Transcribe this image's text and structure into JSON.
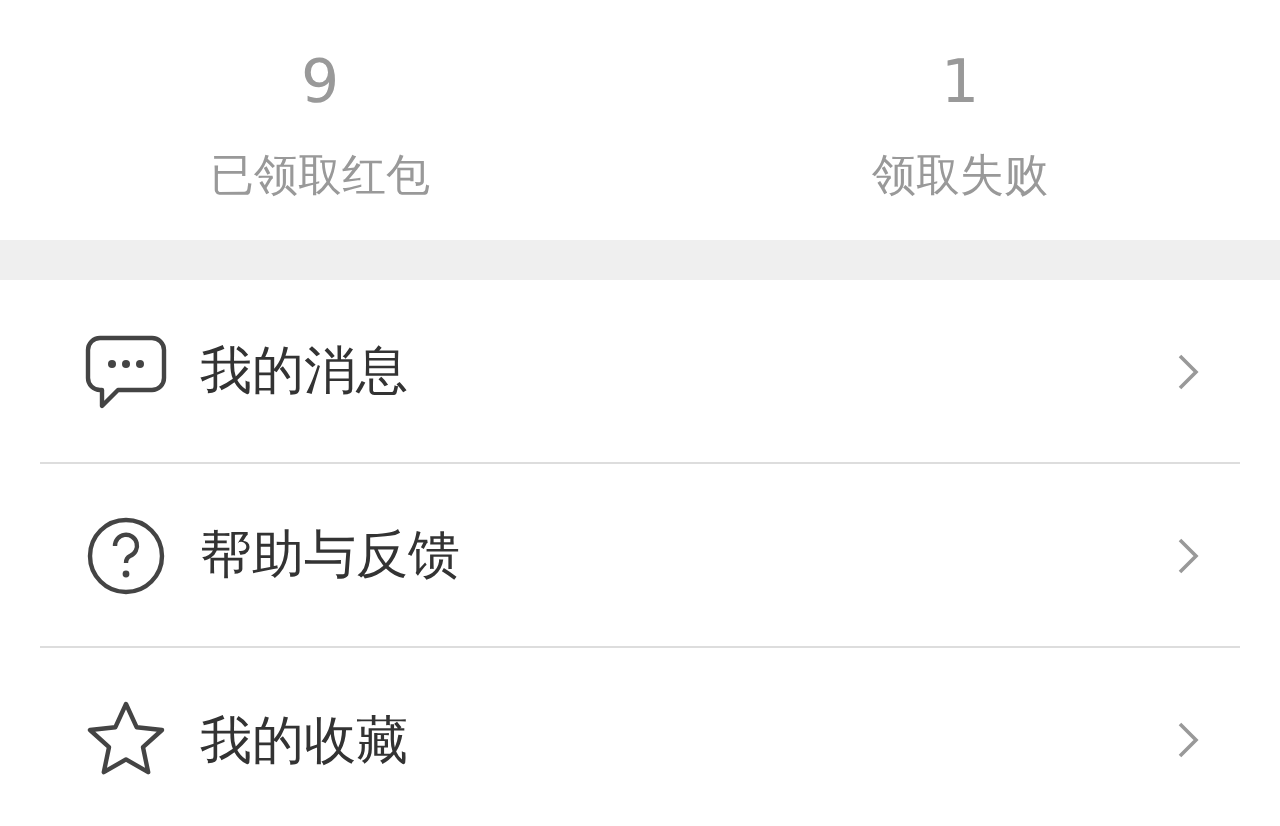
{
  "stats": [
    {
      "value": "9",
      "label": "已领取红包"
    },
    {
      "value": "1",
      "label": "领取失败"
    }
  ],
  "menu": [
    {
      "kind": "messages",
      "label": "我的消息"
    },
    {
      "kind": "help",
      "label": "帮助与反馈"
    },
    {
      "kind": "favorites",
      "label": "我的收藏"
    }
  ]
}
